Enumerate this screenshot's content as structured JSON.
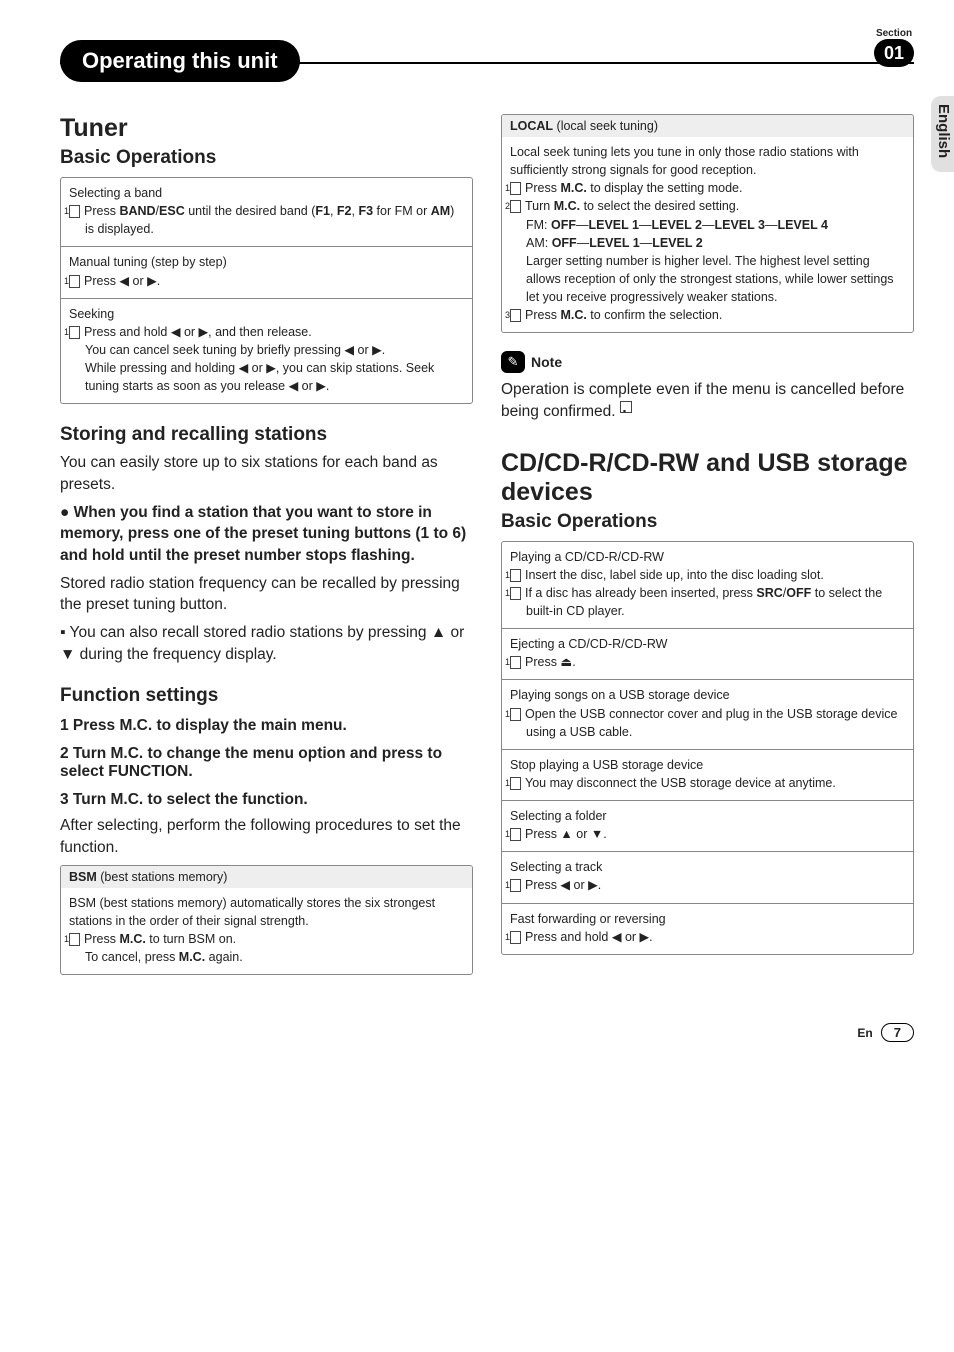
{
  "header": {
    "title": "Operating this unit",
    "section_label": "Section",
    "section_num": "01",
    "lang_tab": "English"
  },
  "left": {
    "h1": "Tuner",
    "h2a": "Basic Operations",
    "box1": {
      "c1_title": "Selecting a band",
      "c1_step": "Press BAND/ESC until the desired band (F1, F2, F3 for FM or AM) is displayed.",
      "c2_title": "Manual tuning (step by step)",
      "c2_step": "Press ◀ or ▶.",
      "c3_title": "Seeking",
      "c3_l1": "Press and hold ◀ or ▶, and then release.",
      "c3_l2": "You can cancel seek tuning by briefly pressing ◀ or ▶.",
      "c3_l3": "While pressing and holding ◀ or ▶, you can skip stations. Seek tuning starts as soon as you release ◀ or ▶."
    },
    "h2b": "Storing and recalling stations",
    "p1": "You can easily store up to six stations for each band as presets.",
    "bullet1": "When you find a station that you want to store in memory, press one of the preset tuning buttons (1 to 6) and hold until the preset number stops flashing.",
    "p2": "Stored radio station frequency can be recalled by pressing the preset tuning button.",
    "bullet2": "You can also recall stored radio stations by pressing ▲ or ▼ during the frequency display.",
    "h2c": "Function settings",
    "s1": "1   Press M.C. to display the main menu.",
    "s2": "2   Turn M.C. to change the menu option and press to select FUNCTION.",
    "s3": "3   Turn M.C. to select the function.",
    "p3": "After selecting, perform the following procedures to set the function.",
    "box2": {
      "head": "BSM (best stations memory)",
      "body1": "BSM (best stations memory) automatically stores the six strongest stations in the order of their signal strength.",
      "step1": "Press M.C. to turn BSM on.",
      "step2": "To cancel, press M.C. again."
    }
  },
  "right": {
    "box1": {
      "head": "LOCAL (local seek tuning)",
      "p1": "Local seek tuning lets you tune in only those radio stations with sufficiently strong signals for good reception.",
      "s1": "Press M.C. to display the setting mode.",
      "s2": "Turn M.C. to select the desired setting.",
      "fm": "FM: OFF—LEVEL 1—LEVEL 2—LEVEL 3—LEVEL 4",
      "am": "AM: OFF—LEVEL 1—LEVEL 2",
      "p2": "Larger setting number is higher level. The highest level setting allows reception of only the strongest stations, while lower settings let you receive progressively weaker stations.",
      "s3": "Press M.C. to confirm the selection."
    },
    "note_label": "Note",
    "note_body": "Operation is complete even if the menu is cancelled before being confirmed.",
    "h1": "CD/CD-R/CD-RW and USB storage devices",
    "h2": "Basic Operations",
    "box2": {
      "c1_title": "Playing a CD/CD-R/CD-RW",
      "c1_s1": "Insert the disc, label side up, into the disc loading slot.",
      "c1_s2": "If a disc has already been inserted, press SRC/OFF to select the built-in CD player.",
      "c2_title": "Ejecting a CD/CD-R/CD-RW",
      "c2_s1": "Press ⏏.",
      "c3_title": "Playing songs on a USB storage device",
      "c3_s1": "Open the USB connector cover and plug in the USB storage device using a USB cable.",
      "c4_title": "Stop playing a USB storage device",
      "c4_s1": "You may disconnect the USB storage device at anytime.",
      "c5_title": "Selecting a folder",
      "c5_s1": "Press ▲ or ▼.",
      "c6_title": "Selecting a track",
      "c6_s1": "Press ◀ or ▶.",
      "c7_title": "Fast forwarding or reversing",
      "c7_s1": "Press and hold ◀ or ▶."
    }
  },
  "footer": {
    "lang_short": "En",
    "page": "7"
  }
}
